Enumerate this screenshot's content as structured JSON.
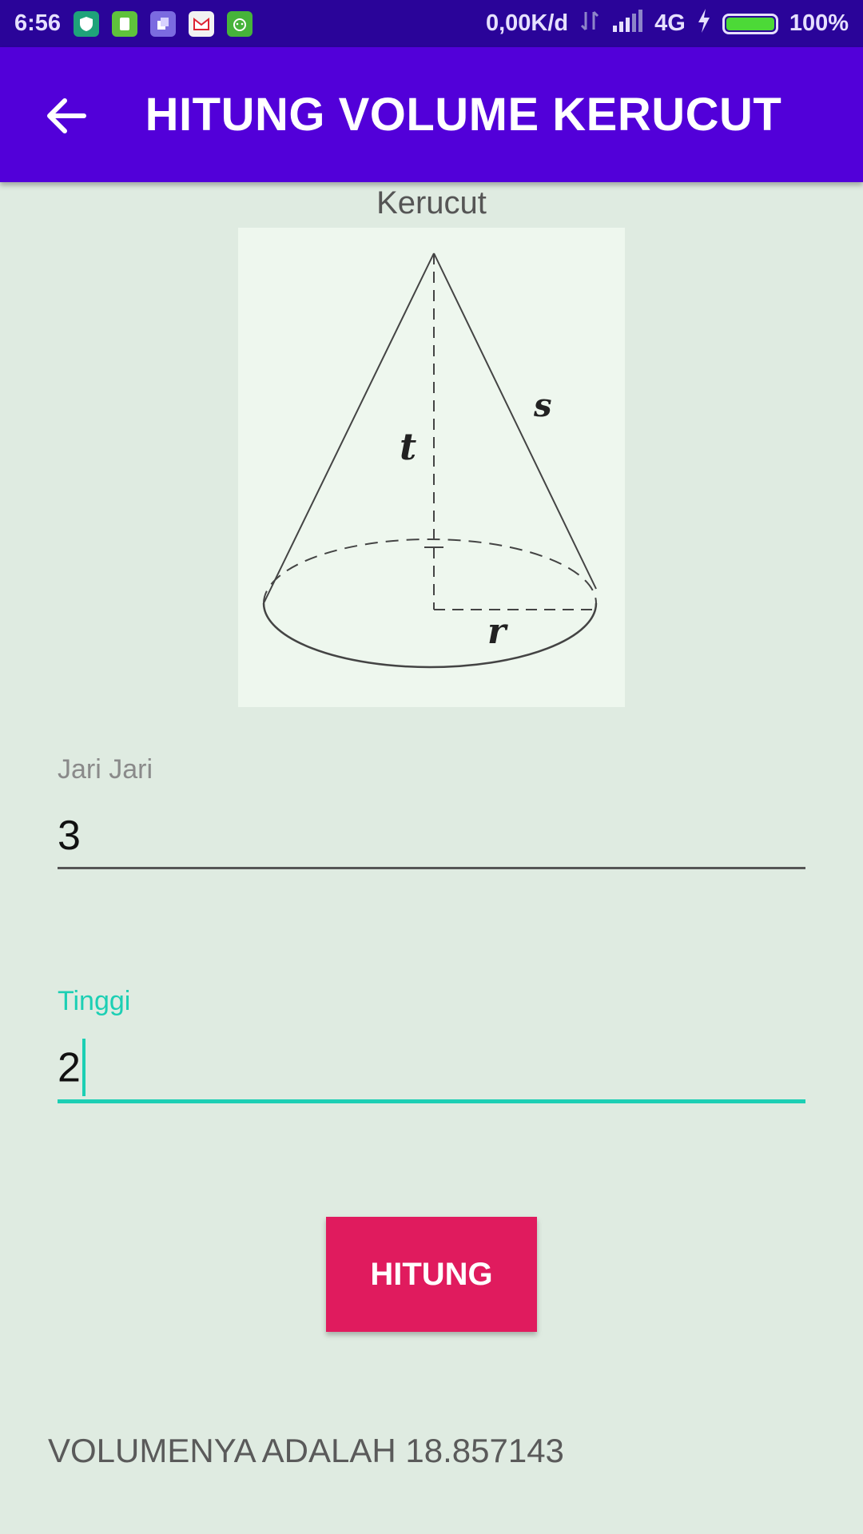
{
  "status_bar": {
    "time": "6:56",
    "network_speed": "0,00K/d",
    "network_type": "4G",
    "battery_percent": "100%",
    "battery_level": 1.0,
    "notification_icons": [
      "shield-app-icon",
      "clipboard-app-icon",
      "files-app-icon",
      "gmail-icon",
      "android-app-icon"
    ]
  },
  "app_bar": {
    "title": "HITUNG VOLUME KERUCUT",
    "back_icon": "arrow-left-icon"
  },
  "figure": {
    "caption": "Kerucut",
    "labels": {
      "slant": "s",
      "height": "t",
      "radius": "r"
    }
  },
  "form": {
    "radius_field": {
      "label": "Jari Jari",
      "value": "3"
    },
    "height_field": {
      "label": "Tinggi",
      "value": "2"
    }
  },
  "button": {
    "label": "HITUNG"
  },
  "result": {
    "text": "VOLUMENYA ADALAH 18.857143"
  },
  "colors": {
    "status_bar": "#2a0499",
    "app_bar": "#5200d9",
    "background": "#dfebe1",
    "accent": "#1ccfb4",
    "button": "#e01b5e"
  }
}
